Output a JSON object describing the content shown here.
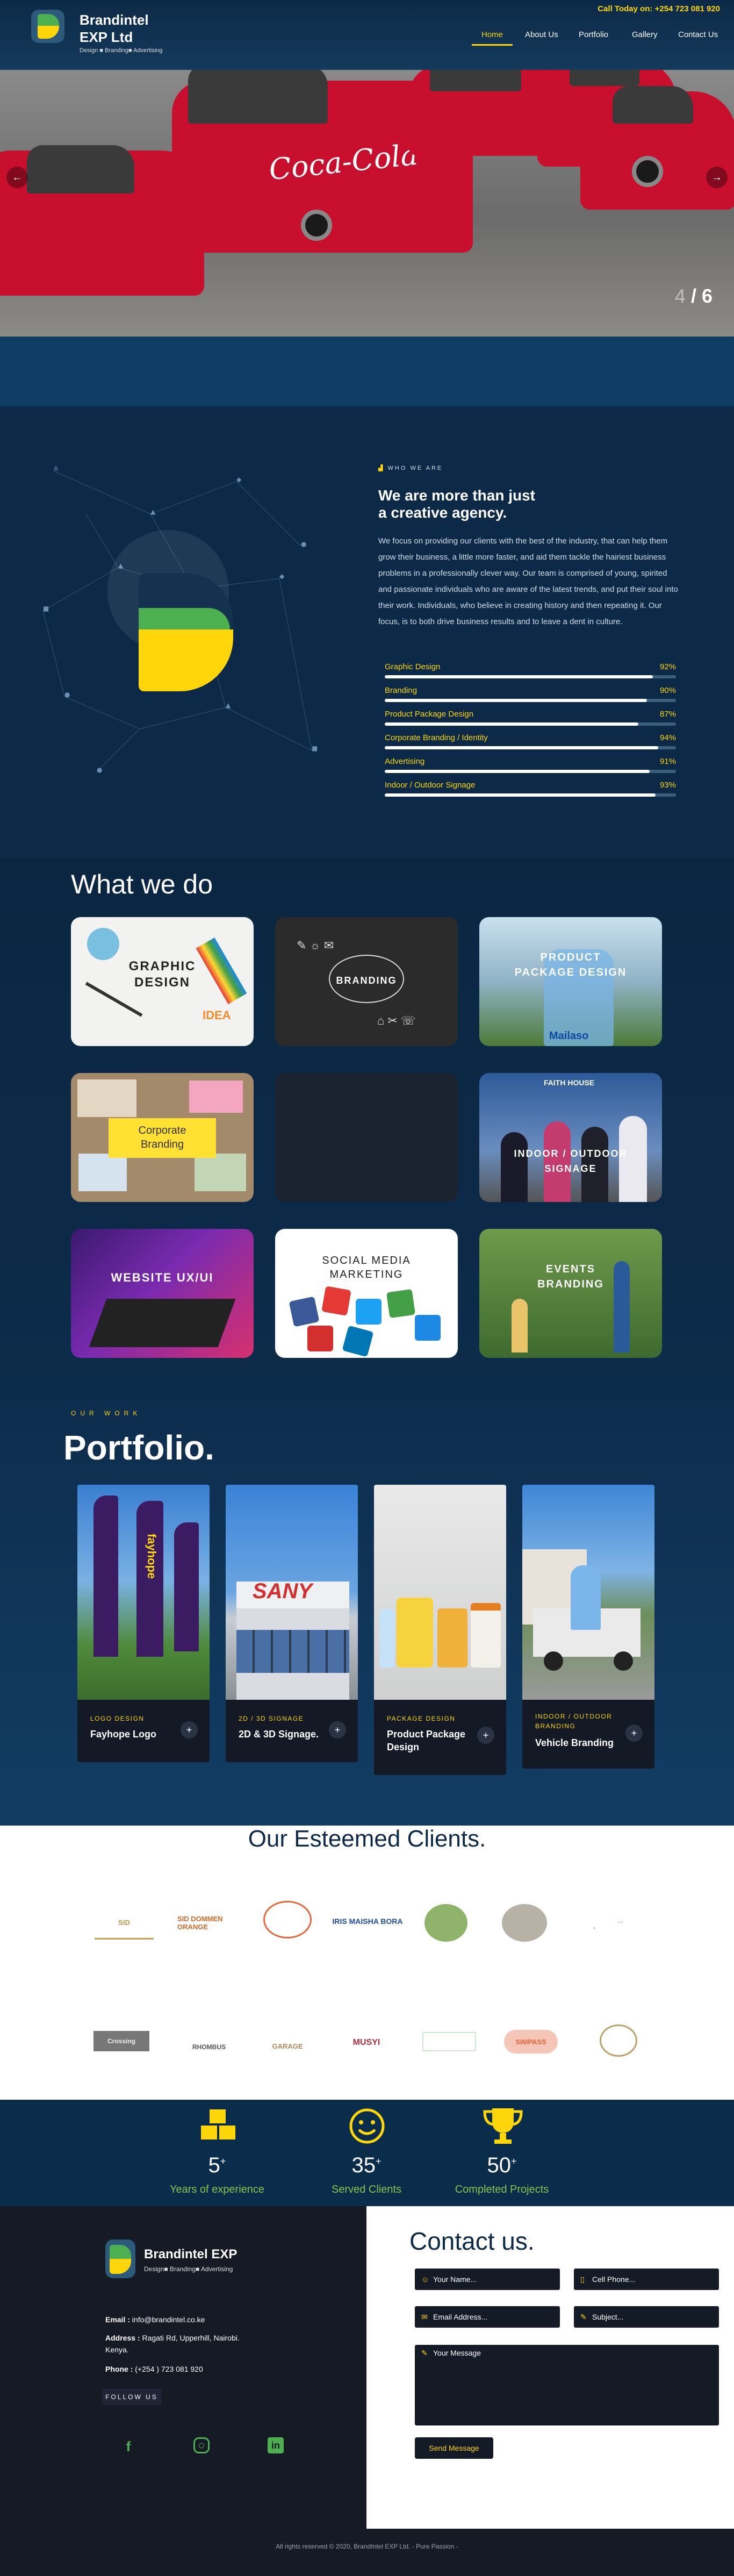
{
  "header": {
    "brand_name": "Brandintel",
    "brand_name2": "EXP Ltd",
    "tagline": "Design ■ Branding■ Advertising",
    "call_label": "Call Today on: +254 723 081 920",
    "nav": [
      "Home",
      "About Us",
      "Portfolio",
      "Gallery",
      "Contact Us"
    ]
  },
  "hero": {
    "brand_text": "Coca-Cola",
    "slide_current": "4",
    "slide_total": "/ 6",
    "prev_arrow": "←",
    "next_arrow": "→"
  },
  "about": {
    "eyebrow": "WHO WE ARE",
    "heading_line1": "We are more than just",
    "heading_line2": "a creative agency.",
    "para1": "We focus on providing our clients with the best of the industry, that can help them grow their business, a little more faster, and aid them tackle the hairiest business problems in a professionally clever way.",
    "para2": "Our team is comprised of young, spirited and passionate individuals who are aware of the latest trends, and put their soul into their work.",
    "para3": "Individuals, who believe in creating history and then repeating it. Our focus, is to both drive business results and to leave a dent in culture.",
    "skills": [
      {
        "name": "Graphic Design",
        "pct": "92%",
        "value": 92
      },
      {
        "name": "Branding",
        "pct": "90%",
        "value": 90
      },
      {
        "name": "Product Package Design",
        "pct": "87%",
        "value": 87
      },
      {
        "name": "Corporate Branding / Identity",
        "pct": "94%",
        "value": 94
      },
      {
        "name": "Advertising",
        "pct": "91%",
        "value": 91
      },
      {
        "name": "Indoor / Outdoor Signage",
        "pct": "93%",
        "value": 93
      }
    ]
  },
  "services": {
    "heading": "What we do",
    "cards": [
      {
        "label": "GRAPHIC\nDESIGN",
        "label1": "GRAPHIC",
        "label2": "DESIGN",
        "extra": "IDEA"
      },
      {
        "label1": "BRANDING",
        "label2": ""
      },
      {
        "label1": "PRODUCT",
        "label2": "PACKAGE DESIGN",
        "extra": "Mailaso"
      },
      {
        "label1": "Corporate",
        "label2": "Branding"
      },
      {
        "label1": "",
        "label2": ""
      },
      {
        "label1": "INDOOR / OUTDOOR",
        "label2": "SIGNAGE",
        "extra": "FAITH HOUSE"
      },
      {
        "label1": "WEBSITE UX/UI",
        "label2": ""
      },
      {
        "label1": "SOCIAL MEDIA",
        "label2": "MARKETING"
      },
      {
        "label1": "EVENTS",
        "label2": "BRANDING"
      }
    ]
  },
  "portfolio": {
    "eyebrow": "OUR WORK",
    "heading": "Portfolio.",
    "items": [
      {
        "category": "LOGO DESIGN",
        "title": "Fayhope Logo",
        "title2": "",
        "brand": "fayhope"
      },
      {
        "category": "2D / 3D SIGNAGE",
        "title": "2D & 3D Signage.",
        "title2": "",
        "brand": "SANY"
      },
      {
        "category": "PACKAGE DESIGN",
        "title": "Product Package",
        "title2": "Design",
        "brand": ""
      },
      {
        "category": "INDOOR / OUTDOOR",
        "category2": "BRANDING",
        "title": "Vehicle Branding",
        "title2": "",
        "brand": ""
      }
    ],
    "plus": "+"
  },
  "clients": {
    "heading": "Our Esteemed Clients.",
    "row1": [
      "SID",
      "SID DOMMEN ORANGE",
      "",
      "IRIS MAISHA BORA",
      "",
      "",
      ""
    ],
    "row2": [
      "Crossing",
      "RHOMBUS",
      "GARAGE",
      "MUSYI",
      "",
      "SIMPASS",
      ""
    ]
  },
  "stats": [
    {
      "num": "5",
      "sup": "+",
      "label": "Years of experience"
    },
    {
      "num": "35",
      "sup": "+",
      "label": "Served Clients"
    },
    {
      "num": "50",
      "sup": "+",
      "label": "Completed Projects"
    }
  ],
  "footer": {
    "brand": "Brandintel EXP",
    "tagline": "Design■ Branding■ Advertising",
    "email_label": "Email :",
    "email": "info@brandintel.co.ke",
    "address_label": "Address :",
    "address": "Ragati Rd, Upperhill, Nairobi. Kenya.",
    "phone_label": "Phone :",
    "phone": "(+254 ) 723 081 920",
    "follow": "FOLLOW US",
    "copyright": "All rights reserved © 2020, BrandIntel EXP Ltd. - Pure Passion -"
  },
  "contact": {
    "heading": "Contact us.",
    "name_ph": "Your Name...",
    "phone_ph": "Cell Phone...",
    "email_ph": "Email Address...",
    "subject_ph": "Subject...",
    "message_ph": "Your Message",
    "send": "Send Message"
  }
}
